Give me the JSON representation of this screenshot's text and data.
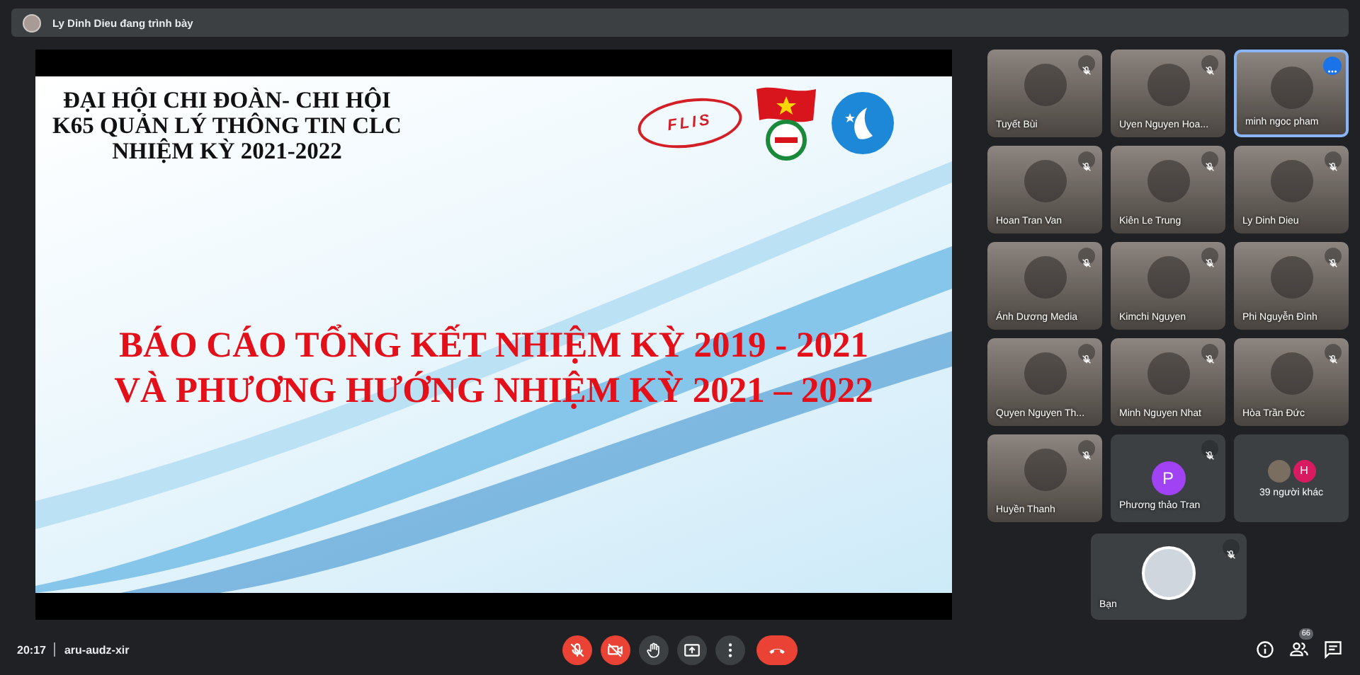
{
  "presenter_bar": {
    "text": "Ly Dinh Dieu đang trình bày"
  },
  "slide": {
    "header": [
      "ĐẠI HỘI CHI ĐOÀN- CHI HỘI",
      "K65 QUẢN LÝ THÔNG TIN CLC",
      "NHIỆM KỲ 2021-2022"
    ],
    "logo_text": "FLIS",
    "title": [
      "BÁO CÁO TỔNG KẾT NHIỆM KỲ 2019 - 2021",
      "VÀ PHƯƠNG HƯỚNG NHIỆM KỲ 2021 – 2022"
    ]
  },
  "participants": [
    {
      "kind": "video",
      "name": "Tuyết Bùi",
      "muted": true,
      "highlighted": false
    },
    {
      "kind": "video",
      "name": "Uyen Nguyen Hoa...",
      "muted": true,
      "highlighted": false
    },
    {
      "kind": "video",
      "name": "minh ngoc pham",
      "muted": false,
      "highlighted": true
    },
    {
      "kind": "video",
      "name": "Hoan Tran Van",
      "muted": true,
      "highlighted": false
    },
    {
      "kind": "video",
      "name": "Kiên Le Trung",
      "muted": true,
      "highlighted": false
    },
    {
      "kind": "video",
      "name": "Ly Dinh Dieu",
      "muted": true,
      "highlighted": false
    },
    {
      "kind": "video",
      "name": "Ánh Dương Media",
      "muted": true,
      "highlighted": false
    },
    {
      "kind": "video",
      "name": "Kimchi Nguyen",
      "muted": true,
      "highlighted": false
    },
    {
      "kind": "video",
      "name": "Phi Nguyễn Đình",
      "muted": true,
      "highlighted": false
    },
    {
      "kind": "video",
      "name": "Quyen Nguyen Th...",
      "muted": true,
      "highlighted": false
    },
    {
      "kind": "video",
      "name": "Minh Nguyen Nhat",
      "muted": true,
      "highlighted": false
    },
    {
      "kind": "video",
      "name": "Hòa Trần Đức",
      "muted": true,
      "highlighted": false
    },
    {
      "kind": "video",
      "name": "Huyền Thanh",
      "muted": true,
      "highlighted": false
    },
    {
      "kind": "initial",
      "name": "Phương thảo Tran",
      "initial": "P",
      "color": "#a142f4",
      "muted": true,
      "highlighted": false
    },
    {
      "kind": "others",
      "name": "39 người khác",
      "initial": "H",
      "color": "#d81b60",
      "muted": false,
      "highlighted": false
    }
  ],
  "self_tile": {
    "name": "Bạn",
    "muted": true
  },
  "bottom_bar": {
    "time": "20:17",
    "meeting_code": "aru-audz-xir",
    "controls": [
      {
        "kind": "mic",
        "off": true
      },
      {
        "kind": "camera",
        "off": true
      },
      {
        "kind": "hand"
      },
      {
        "kind": "present"
      },
      {
        "kind": "more"
      },
      {
        "kind": "hangup"
      }
    ],
    "participant_count": "66"
  }
}
